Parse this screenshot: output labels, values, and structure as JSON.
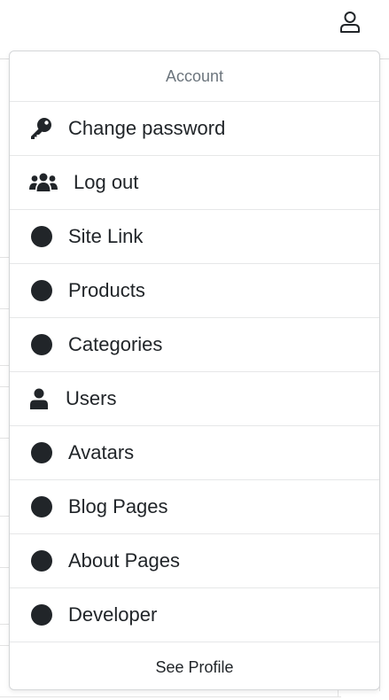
{
  "topbar": {
    "user_icon": "user-outline-icon"
  },
  "dropdown": {
    "header": "Account",
    "items": [
      {
        "label": "Change password",
        "icon": "key-icon"
      },
      {
        "label": "Log out",
        "icon": "users-icon"
      },
      {
        "label": "Site Link",
        "icon": "circle-icon"
      },
      {
        "label": "Products",
        "icon": "circle-icon"
      },
      {
        "label": "Categories",
        "icon": "circle-icon"
      },
      {
        "label": "Users",
        "icon": "user-icon"
      },
      {
        "label": "Avatars",
        "icon": "circle-icon"
      },
      {
        "label": "Blog Pages",
        "icon": "circle-icon"
      },
      {
        "label": "About Pages",
        "icon": "circle-icon"
      },
      {
        "label": "Developer",
        "icon": "circle-icon"
      }
    ],
    "footer": "See Profile"
  },
  "colors": {
    "text": "#212529",
    "muted": "#6c757d",
    "border": "#e6e7e8"
  }
}
